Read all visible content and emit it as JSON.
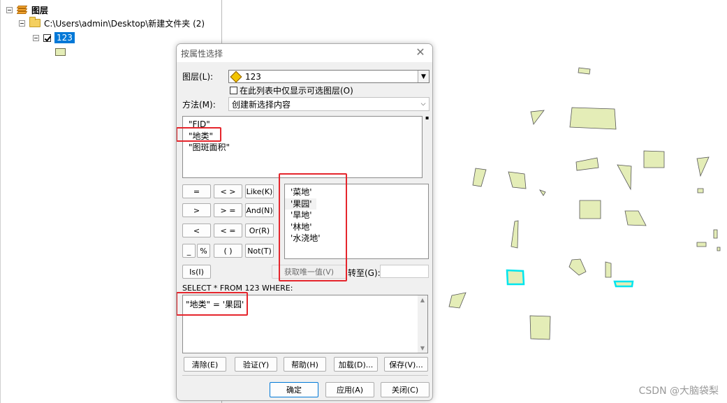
{
  "toc": {
    "root_label": "图层",
    "folder_label": "C:\\Users\\admin\\Desktop\\新建文件夹 (2)",
    "layer_label": "123"
  },
  "dialog": {
    "title": "按属性选择",
    "layer_label": "图层(L):",
    "layer_value": "123",
    "only_selectable_label": "在此列表中仅显示可选图层(O)",
    "method_label": "方法(M):",
    "method_value": "创建新选择内容",
    "fields": [
      "\"FID\"",
      "\"地类\"",
      "\"图斑面积\""
    ],
    "values": [
      "'菜地'",
      "'果园'",
      "'旱地'",
      "'林地'",
      "'水浇地'"
    ],
    "operators": {
      "eq": "=",
      "ne": "< >",
      "like": "Like(K)",
      "gt": ">",
      "ge": "> =",
      "and": "And(N)",
      "lt": "<",
      "le": "< =",
      "or": "Or(R)",
      "underscore": "_",
      "percent": "%",
      "paren": "( )",
      "not": "Not(T)",
      "is": "Is(I)"
    },
    "get_unique_values": "获取唯一值(V)",
    "goto_label": "转至(G):",
    "goto_value": "",
    "sql_prefix": "SELECT * FROM 123 WHERE:",
    "sql_expression": "\"地类\" = '果园'",
    "buttons": {
      "clear": "清除(E)",
      "verify": "验证(Y)",
      "help": "帮助(H)",
      "load": "加载(D)...",
      "save": "保存(V)...",
      "ok": "确定",
      "apply": "应用(A)",
      "close": "关闭(C)"
    }
  },
  "map": {
    "feature_fill": "#e4edb7",
    "feature_stroke": "#555555",
    "selection_color": "#00e5ee"
  },
  "watermark": "CSDN @大脑袋梨",
  "highlight_color": "#e5252c"
}
